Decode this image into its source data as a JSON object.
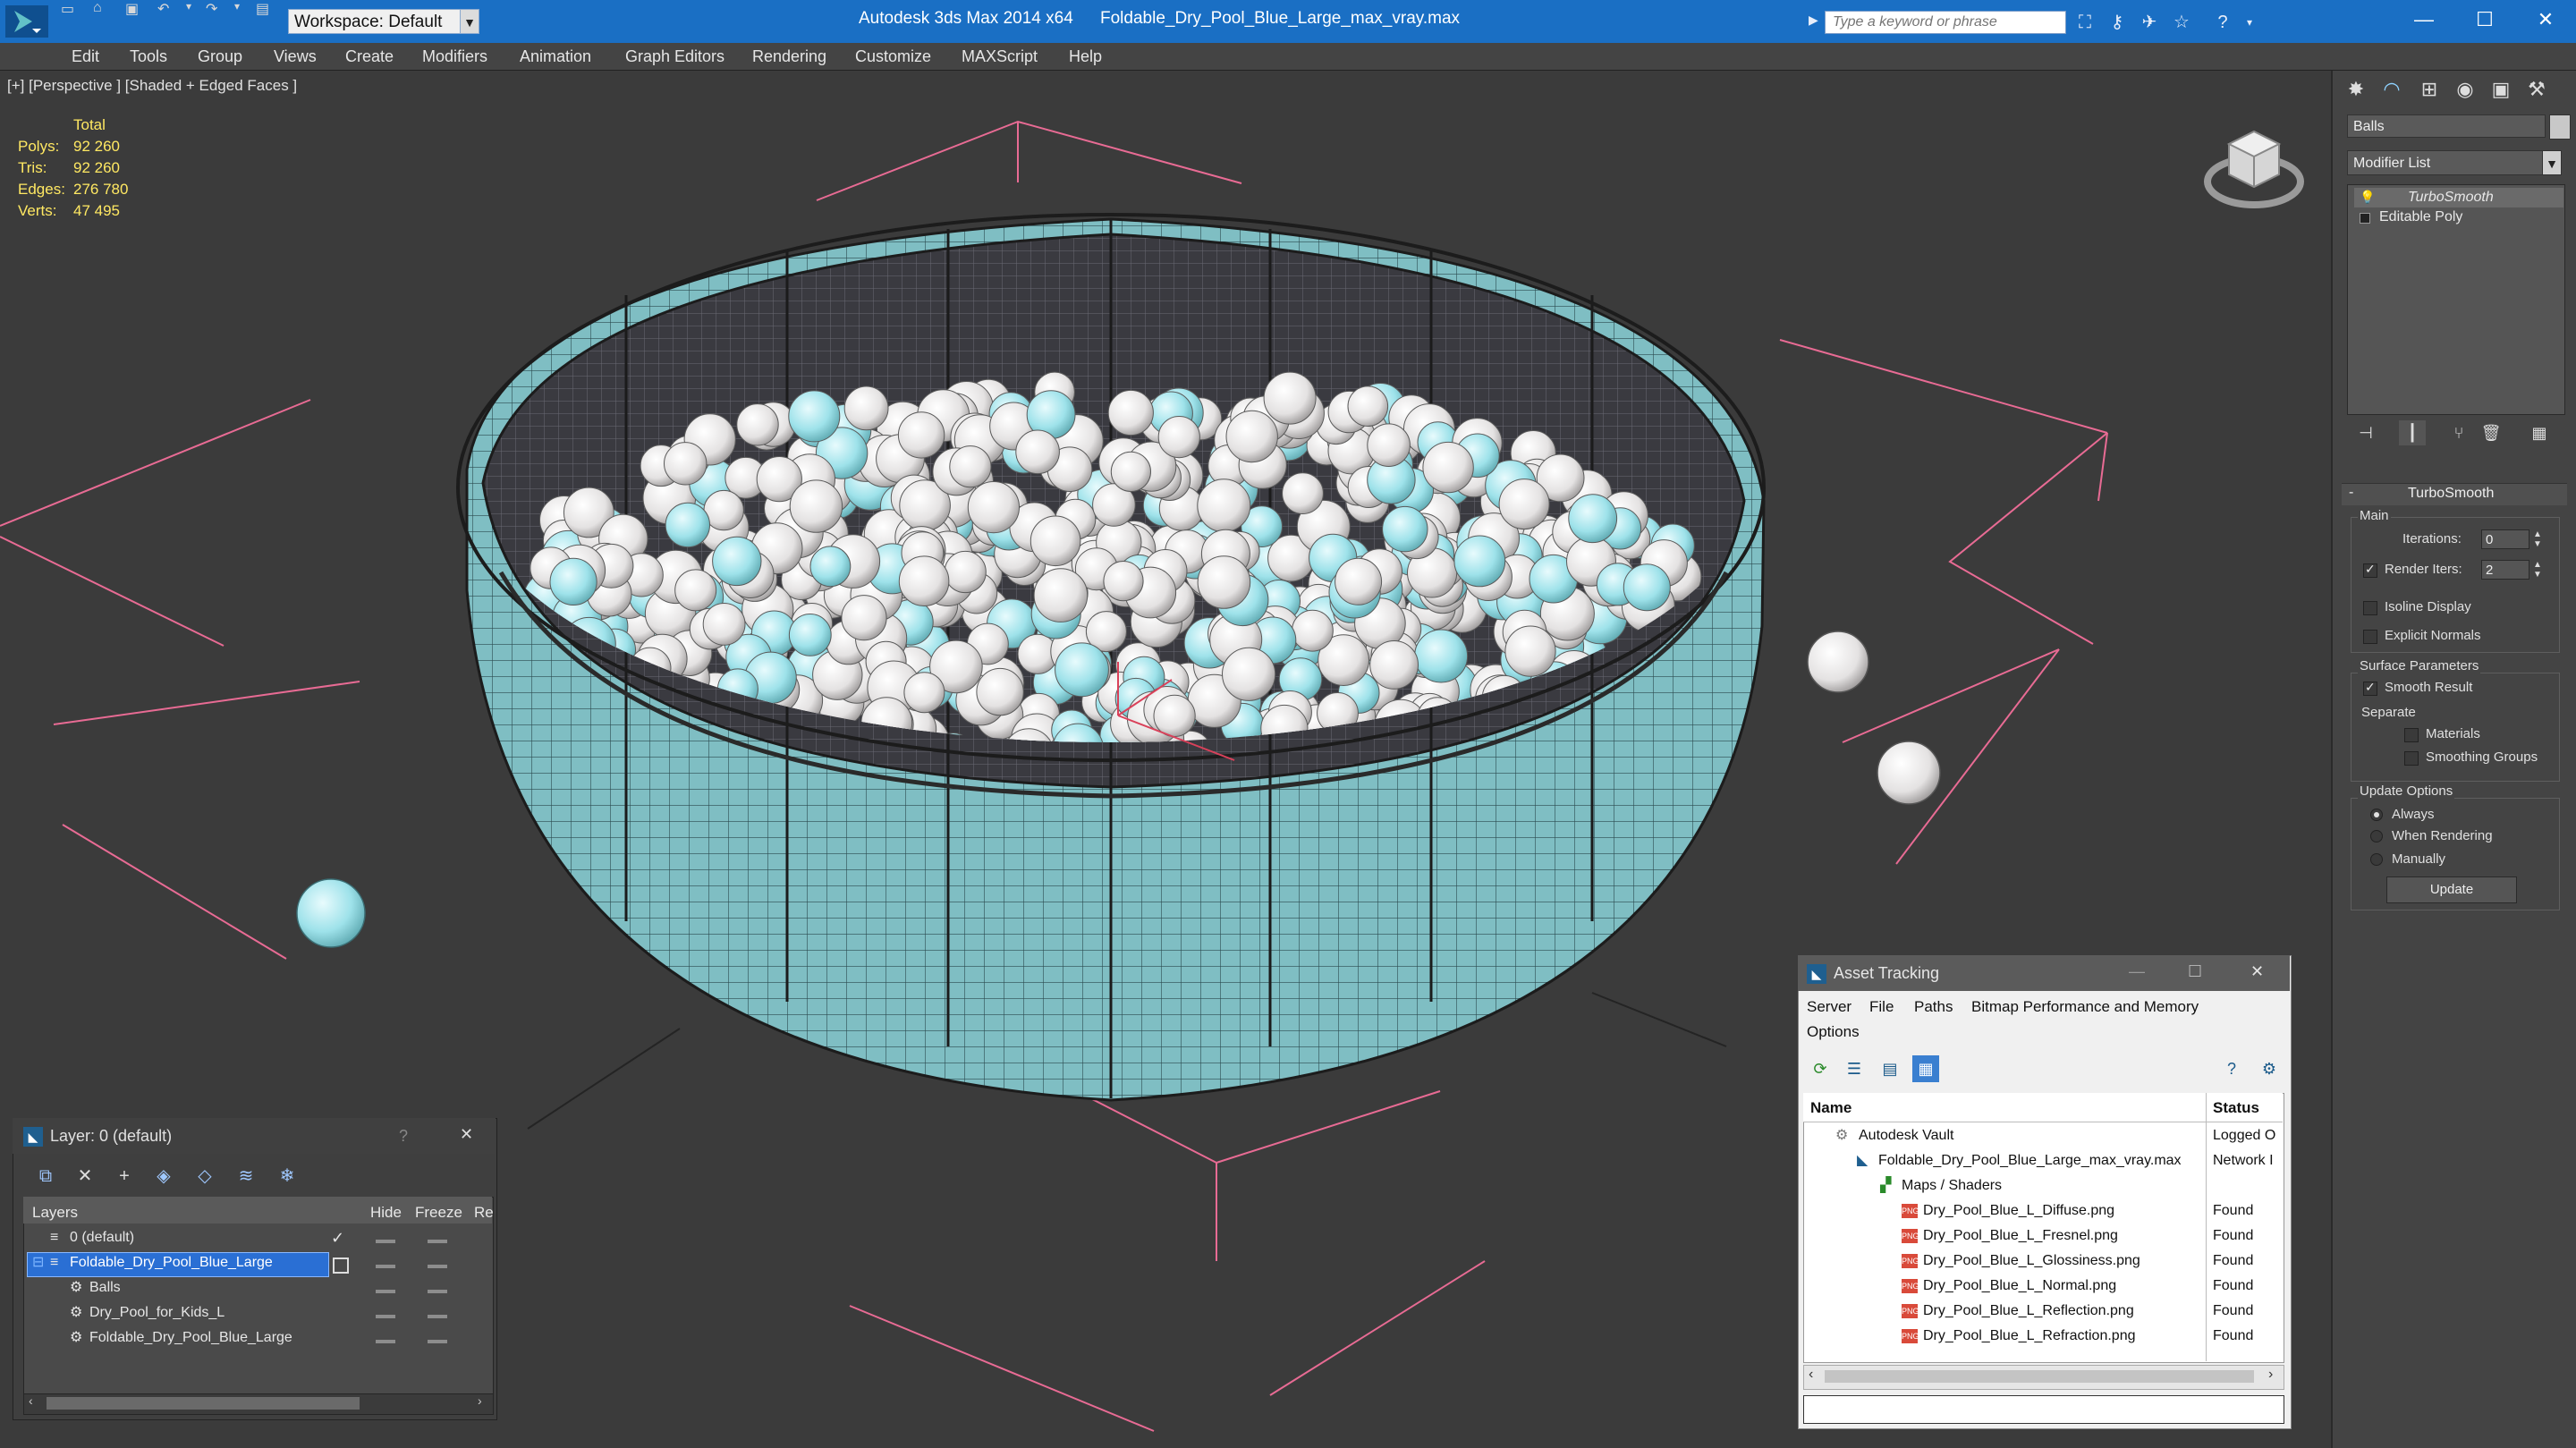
{
  "titlebar": {
    "workspace": "Workspace: Default",
    "app_title": "Autodesk 3ds Max  2014 x64",
    "file_title": "Foldable_Dry_Pool_Blue_Large_max_vray.max",
    "search_placeholder": "Type a keyword or phrase"
  },
  "menu": [
    "Edit",
    "Tools",
    "Group",
    "Views",
    "Create",
    "Modifiers",
    "Animation",
    "Graph Editors",
    "Rendering",
    "Customize",
    "MAXScript",
    "Help"
  ],
  "viewport": {
    "label": "[+] [Perspective ] [Shaded + Edged Faces ]",
    "stats": {
      "header": "Total",
      "rows": [
        {
          "label": "Polys:",
          "value": "92 260"
        },
        {
          "label": "Tris:",
          "value": "92 260"
        },
        {
          "label": "Edges:",
          "value": "276 780"
        },
        {
          "label": "Verts:",
          "value": "47 495"
        }
      ]
    }
  },
  "command_panel": {
    "object_name": "Balls",
    "modifier_list": "Modifier List",
    "stack": [
      "TurboSmooth",
      "Editable Poly"
    ],
    "rollout_title": "TurboSmooth",
    "main_label": "Main",
    "iterations_label": "Iterations:",
    "iterations_value": "0",
    "render_iters_label": "Render Iters:",
    "render_iters_value": "2",
    "isoline_label": "Isoline Display",
    "explicit_normals_label": "Explicit Normals",
    "surface_params_label": "Surface Parameters",
    "smooth_result_label": "Smooth Result",
    "separate_label": "Separate",
    "materials_label": "Materials",
    "smoothing_groups_label": "Smoothing Groups",
    "update_options_label": "Update Options",
    "always_label": "Always",
    "when_rendering_label": "When Rendering",
    "manually_label": "Manually",
    "update_button": "Update",
    "checks": {
      "render_iters": true,
      "isoline": false,
      "explicit_normals": false,
      "smooth_result": true,
      "materials": false,
      "smoothing_groups": false
    },
    "update_mode": "Always"
  },
  "layer_window": {
    "title": "Layer: 0 (default)",
    "help": "?",
    "col_layers": "Layers",
    "col_hide": "Hide",
    "col_freeze": "Freeze",
    "col_render": "Re",
    "rows": [
      {
        "name": "0 (default)"
      },
      {
        "name": "Foldable_Dry_Pool_Blue_Large"
      },
      {
        "name": "Balls"
      },
      {
        "name": "Dry_Pool_for_Kids_L"
      },
      {
        "name": "Foldable_Dry_Pool_Blue_Large"
      }
    ]
  },
  "asset_window": {
    "title": "Asset Tracking",
    "menu": [
      "Server",
      "File",
      "Paths",
      "Bitmap Performance and Memory",
      "Options"
    ],
    "col_name": "Name",
    "col_status": "Status",
    "rows": [
      {
        "name": "Autodesk Vault",
        "status": "Logged O"
      },
      {
        "name": "Foldable_Dry_Pool_Blue_Large_max_vray.max",
        "status": "Network I"
      },
      {
        "name": "Maps / Shaders",
        "status": ""
      },
      {
        "name": "Dry_Pool_Blue_L_Diffuse.png",
        "status": "Found"
      },
      {
        "name": "Dry_Pool_Blue_L_Fresnel.png",
        "status": "Found"
      },
      {
        "name": "Dry_Pool_Blue_L_Glossiness.png",
        "status": "Found"
      },
      {
        "name": "Dry_Pool_Blue_L_Normal.png",
        "status": "Found"
      },
      {
        "name": "Dry_Pool_Blue_L_Reflection.png",
        "status": "Found"
      },
      {
        "name": "Dry_Pool_Blue_L_Refraction.png",
        "status": "Found"
      }
    ],
    "png_badge": "PNG"
  },
  "colors": {
    "titlebar": "#1a6fc4",
    "pool_teal": "#7fc0c4",
    "ball_teal": "#9fe3ec",
    "ball_white": "#efeded",
    "grid_pink": "#e86b94"
  }
}
